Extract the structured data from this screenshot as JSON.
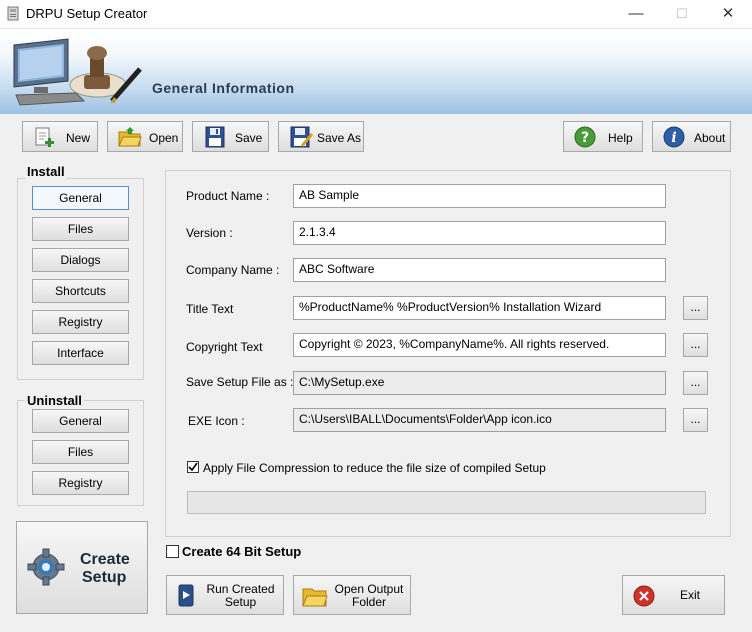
{
  "window": {
    "title": "DRPU Setup Creator",
    "minimize": "—",
    "maximize": "☐",
    "close": "✕"
  },
  "header": {
    "section_title": "General Information"
  },
  "toolbar": {
    "new": "New",
    "open": "Open",
    "save": "Save",
    "save_as": "Save As",
    "help": "Help",
    "about": "About"
  },
  "install": {
    "label": "Install",
    "items": [
      "General",
      "Files",
      "Dialogs",
      "Shortcuts",
      "Registry",
      "Interface"
    ]
  },
  "uninstall": {
    "label": "Uninstall",
    "items": [
      "General",
      "Files",
      "Registry"
    ]
  },
  "form": {
    "product_name": {
      "label": "Product Name :",
      "value": "AB Sample"
    },
    "version": {
      "label": "Version :",
      "value": "2.1.3.4"
    },
    "company_name": {
      "label": "Company Name :",
      "value": "ABC Software"
    },
    "title_text": {
      "label": "Title Text",
      "value": "%ProductName% %ProductVersion% Installation Wizard"
    },
    "copyright_text": {
      "label": "Copyright Text",
      "value": "Copyright © 2023, %CompanyName%. All rights reserved."
    },
    "save_setup": {
      "label": "Save Setup File as :",
      "value": "C:\\MySetup.exe"
    },
    "exe_icon": {
      "label": "EXE Icon :",
      "value": "C:\\Users\\IBALL\\Documents\\Folder\\App icon.ico"
    },
    "browse": "...",
    "compression": {
      "label": "Apply File Compression to reduce the file size of compiled Setup",
      "checked": true
    }
  },
  "create_setup": {
    "line1": "Create",
    "line2": "Setup"
  },
  "create64": {
    "label": "Create 64 Bit Setup",
    "checked": false
  },
  "bottom": {
    "run_line1": "Run Created",
    "run_line2": "Setup",
    "open_line1": "Open Output",
    "open_line2": "Folder",
    "exit": "Exit"
  }
}
